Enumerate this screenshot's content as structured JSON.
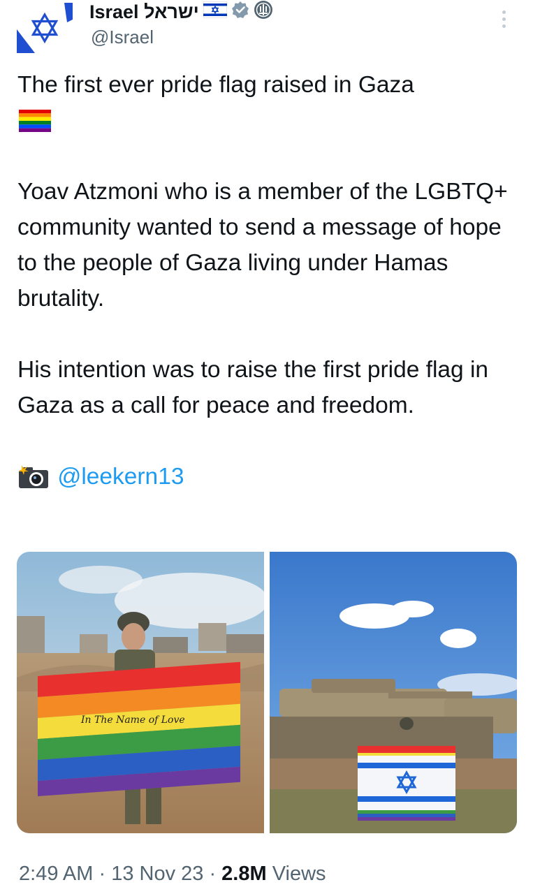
{
  "header": {
    "display_name": "Israel ישראל",
    "handle": "@Israel",
    "badges": [
      "israel-flag-icon",
      "verified-badge-icon",
      "government-seal-icon"
    ]
  },
  "tweet": {
    "line1": "The first ever pride flag raised in Gaza",
    "emoji_1": "rainbow-flag-icon",
    "paragraph2": "Yoav Atzmoni who is a member of the LGBTQ+ community wanted to send a message of hope to the people of Gaza living under Hamas brutality.",
    "paragraph3": "His intention was to raise the first pride flag in Gaza as a call for peace and freedom.",
    "camera_emoji": "camera-flash-icon",
    "credit_handle": "@leekern13"
  },
  "media": {
    "photo1_flag_text": "In The Name of Love"
  },
  "footer": {
    "time": "2:49 AM",
    "sep1": " · ",
    "date": "13 Nov 23",
    "sep2": " · ",
    "views_count": "2.8M",
    "views_label": " Views"
  },
  "colors": {
    "link": "#1d9bf0",
    "secondary_text": "#536471",
    "primary_text": "#0f1419",
    "israel_blue": "#0038b8"
  }
}
